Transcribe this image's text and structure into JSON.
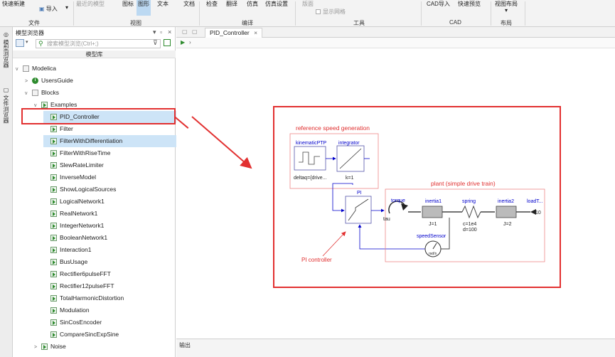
{
  "ribbon": {
    "buttons": [
      {
        "label": "快速新建",
        "dim": false
      },
      {
        "label": "导入",
        "dim": false
      },
      {
        "label": "最近的模型",
        "dim": true
      },
      {
        "label": "图标",
        "dim": false
      },
      {
        "label": "图形",
        "dim": false,
        "active": true
      },
      {
        "label": "文本",
        "dim": false
      },
      {
        "label": "文档",
        "dim": false
      },
      {
        "label": "检查",
        "dim": false
      },
      {
        "label": "翻译",
        "dim": false
      },
      {
        "label": "仿真",
        "dim": false
      },
      {
        "label": "仿真设置",
        "dim": false
      },
      {
        "label": "版面",
        "dim": true
      },
      {
        "label": "显示网格",
        "dim": true
      },
      {
        "label": "CAD导入",
        "dim": false
      },
      {
        "label": "快速预览",
        "dim": false
      },
      {
        "label": "视图布局",
        "dim": false
      }
    ],
    "groups": [
      "文件",
      "视图",
      "编译",
      "工具",
      "CAD",
      "布局"
    ]
  },
  "side_tabs": [
    "模型浏览器",
    "文件浏览器"
  ],
  "browser": {
    "title": "模型浏览器",
    "search_placeholder": "搜索模型浏览(Ctrl+;)",
    "library_header": "模型库",
    "tree": [
      {
        "label": "Modelica",
        "indent": 0,
        "toggle": "v",
        "icon": "grey"
      },
      {
        "label": "UsersGuide",
        "indent": 1,
        "toggle": ">",
        "icon": "info"
      },
      {
        "label": "Blocks",
        "indent": 1,
        "toggle": "v",
        "icon": "grey"
      },
      {
        "label": "Examples",
        "indent": 2,
        "toggle": "v",
        "icon": "play"
      },
      {
        "label": "PID_Controller",
        "indent": 3,
        "toggle": "",
        "icon": "play",
        "selected": true
      },
      {
        "label": "Filter",
        "indent": 3,
        "toggle": "",
        "icon": "play"
      },
      {
        "label": "FilterWithDifferentiation",
        "indent": 3,
        "toggle": "",
        "icon": "play",
        "selected": true
      },
      {
        "label": "FilterWithRiseTime",
        "indent": 3,
        "toggle": "",
        "icon": "play"
      },
      {
        "label": "SlewRateLimiter",
        "indent": 3,
        "toggle": "",
        "icon": "play"
      },
      {
        "label": "InverseModel",
        "indent": 3,
        "toggle": "",
        "icon": "play"
      },
      {
        "label": "ShowLogicalSources",
        "indent": 3,
        "toggle": "",
        "icon": "play"
      },
      {
        "label": "LogicalNetwork1",
        "indent": 3,
        "toggle": "",
        "icon": "play"
      },
      {
        "label": "RealNetwork1",
        "indent": 3,
        "toggle": "",
        "icon": "play"
      },
      {
        "label": "IntegerNetwork1",
        "indent": 3,
        "toggle": "",
        "icon": "play"
      },
      {
        "label": "BooleanNetwork1",
        "indent": 3,
        "toggle": "",
        "icon": "play"
      },
      {
        "label": "Interaction1",
        "indent": 3,
        "toggle": "",
        "icon": "play"
      },
      {
        "label": "BusUsage",
        "indent": 3,
        "toggle": "",
        "icon": "play"
      },
      {
        "label": "Rectifier6pulseFFT",
        "indent": 3,
        "toggle": "",
        "icon": "play"
      },
      {
        "label": "Rectifier12pulseFFT",
        "indent": 3,
        "toggle": "",
        "icon": "play"
      },
      {
        "label": "TotalHarmonicDistortion",
        "indent": 3,
        "toggle": "",
        "icon": "play"
      },
      {
        "label": "Modulation",
        "indent": 3,
        "toggle": "",
        "icon": "play"
      },
      {
        "label": "SinCosEncoder",
        "indent": 3,
        "toggle": "",
        "icon": "play"
      },
      {
        "label": "CompareSincExpSine",
        "indent": 3,
        "toggle": "",
        "icon": "play"
      },
      {
        "label": "Noise",
        "indent": 2,
        "toggle": ">",
        "icon": "play"
      }
    ]
  },
  "editor": {
    "tab_label": "PID_Controller",
    "tab_close": "×",
    "output_title": "输出"
  },
  "diagram": {
    "ref_title": "reference speed generation",
    "plant_title": "plant (simple drive train)",
    "kinematic": "kinematicPTP",
    "kinematic_param": "deltaq={drive...",
    "integrator": "integrator",
    "integrator_param": "k=1",
    "pi": "PI",
    "torque": "torque",
    "tau": "tau",
    "inertia1": "inertia1",
    "inertia1_param": "J=1",
    "spring": "spring",
    "spring_c": "c=1e4",
    "spring_d": "d=100",
    "inertia2": "inertia2",
    "inertia2_param": "J=2",
    "load": "loadT...",
    "load_value": "10",
    "speed_sensor": "speedSensor",
    "speed_unit": "rad/s",
    "pi_annotation": "PI controller"
  },
  "colors": {
    "highlight_red": "#e23030",
    "selection_blue": "#cde4f7",
    "active_ribbon": "#bcd9f2",
    "diagram_blue": "#0000cc",
    "diagram_red": "#e03030"
  }
}
